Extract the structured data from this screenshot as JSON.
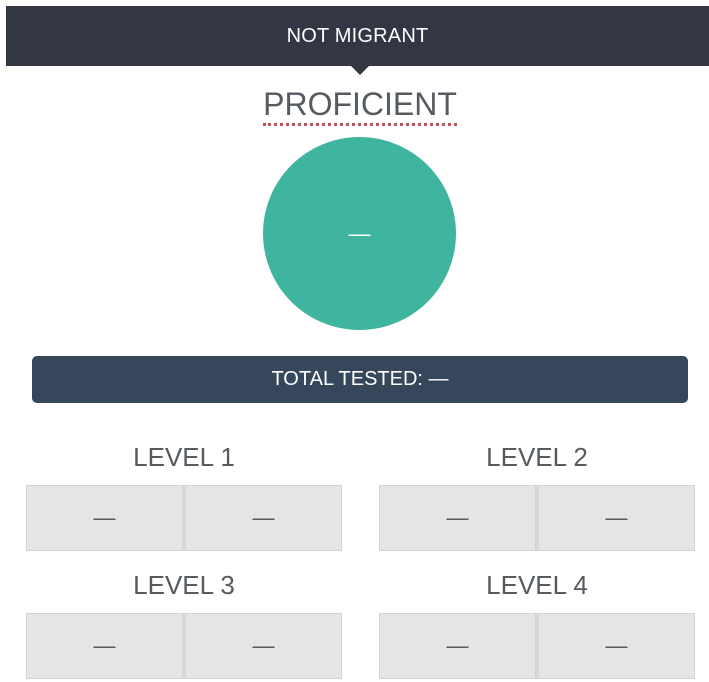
{
  "header": {
    "label": "NOT MIGRANT"
  },
  "summary": {
    "title": "PROFICIENT",
    "value": "—",
    "total_tested": "TOTAL TESTED: —"
  },
  "levels": [
    {
      "label": "LEVEL 1",
      "values": [
        "—",
        "—"
      ]
    },
    {
      "label": "LEVEL 2",
      "values": [
        "—",
        "—"
      ]
    },
    {
      "label": "LEVEL 3",
      "values": [
        "—",
        "—"
      ]
    },
    {
      "label": "LEVEL 4",
      "values": [
        "—",
        "—"
      ]
    }
  ],
  "colors": {
    "header_bg": "#333743",
    "circle": "#3fb59f",
    "total_bar_bg": "#37475b",
    "cell_bg": "#e5e5e5",
    "underline": "#c0505c"
  }
}
